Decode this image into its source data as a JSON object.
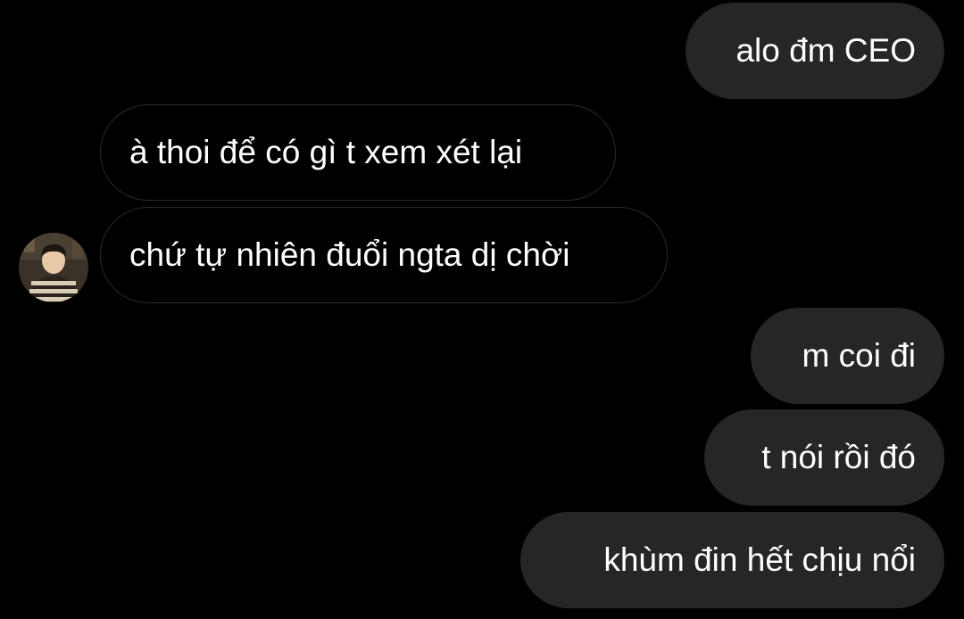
{
  "colors": {
    "background": "#000000",
    "sent_bubble": "#262626",
    "received_bubble_border": "#2a2a2a",
    "text": "#ffffff"
  },
  "messages": [
    {
      "sender": "me",
      "text": "alo đm CEO"
    },
    {
      "sender": "them",
      "text": "à thoi để có gì t xem xét lại"
    },
    {
      "sender": "them",
      "text": "chứ tự nhiên đuổi ngta dị chời"
    },
    {
      "sender": "me",
      "text": "m coi đi"
    },
    {
      "sender": "me",
      "text": "t nói rồi đó"
    },
    {
      "sender": "me",
      "text": "khùm đin hết chịu nổi"
    }
  ],
  "contact": {
    "avatar_icon": "user-avatar-photo"
  }
}
